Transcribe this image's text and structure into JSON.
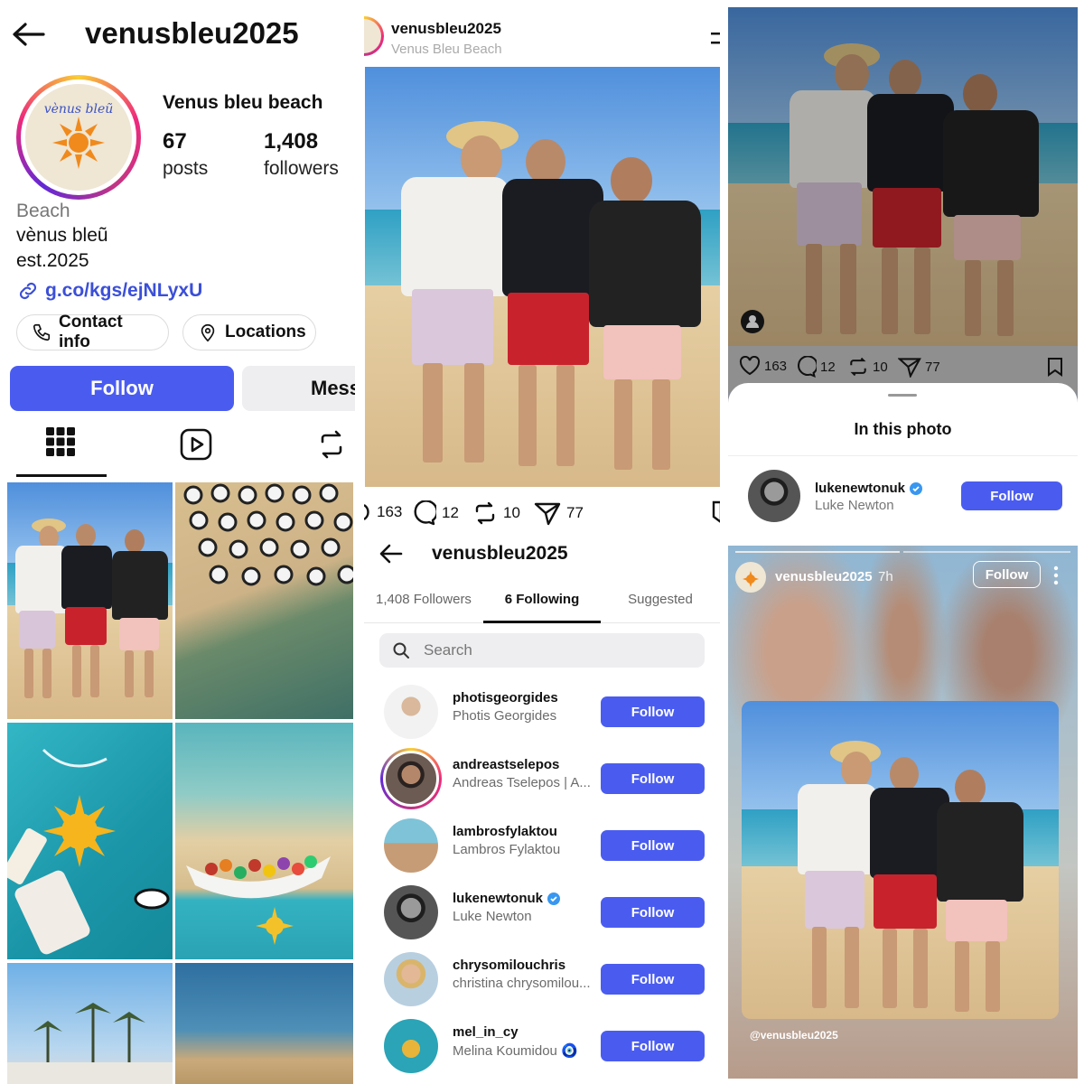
{
  "profile": {
    "username": "venusbleu2025",
    "display_name": "Venus bleu beach",
    "avatar_logo_text": "vènus bleũ",
    "stats": {
      "posts_count": "67",
      "posts_label": "posts",
      "followers_count": "1,408",
      "followers_label": "followers"
    },
    "category": "Beach",
    "bio_line1": "vènus bleũ",
    "bio_line2": "est.2025",
    "link": "g.co/kgs/ejNLyxU",
    "contact_label": "Contact info",
    "locations_label": "Locations",
    "follow_label": "Follow",
    "message_label": "Mess",
    "icons": {
      "back": "back-arrow-icon",
      "link": "link-icon",
      "phone": "phone-icon",
      "pin": "location-pin-icon",
      "grid": "grid-icon",
      "reels": "reels-icon",
      "reposts": "repost-icon"
    }
  },
  "post": {
    "username": "venusbleu2025",
    "location": "Venus Bleu Beach",
    "likes": "163",
    "comments": "12",
    "reposts": "10",
    "shares": "77"
  },
  "following_page": {
    "title": "venusbleu2025",
    "tabs": [
      {
        "label": "1,408 Followers"
      },
      {
        "label": "6 Following"
      },
      {
        "label": "Suggested"
      }
    ],
    "active_tab": "6 Following",
    "search_placeholder": "Search",
    "users": [
      {
        "username": "photisgeorgides",
        "name": "Photis Georgides",
        "verified": false,
        "button": "Follow"
      },
      {
        "username": "andreastselepos",
        "name": "Andreas Tselepos | A...",
        "verified": false,
        "button": "Follow"
      },
      {
        "username": "lambrosfylaktou",
        "name": "Lambros Fylaktou",
        "verified": false,
        "button": "Follow"
      },
      {
        "username": "lukenewtonuk",
        "name": "Luke Newton",
        "verified": true,
        "button": "Follow"
      },
      {
        "username": "chrysomilouchris",
        "name": "christina chrysomilou...",
        "verified": false,
        "button": "Follow"
      },
      {
        "username": "mel_in_cy",
        "name": "Melina Koumidou 🧿",
        "verified": false,
        "button": "Follow"
      }
    ]
  },
  "tagged_sheet": {
    "likes": "163",
    "comments": "12",
    "reposts": "10",
    "shares": "77",
    "title": "In this photo",
    "user": {
      "username": "lukenewtonuk",
      "name": "Luke Newton",
      "verified": true,
      "button": "Follow"
    }
  },
  "story": {
    "username": "venusbleu2025",
    "time": "7h",
    "follow_label": "Follow",
    "mention": "@venusbleu2025"
  },
  "colors": {
    "accent": "#4a5cf0",
    "verified": "#3897f0",
    "link": "#3b4fd8"
  }
}
